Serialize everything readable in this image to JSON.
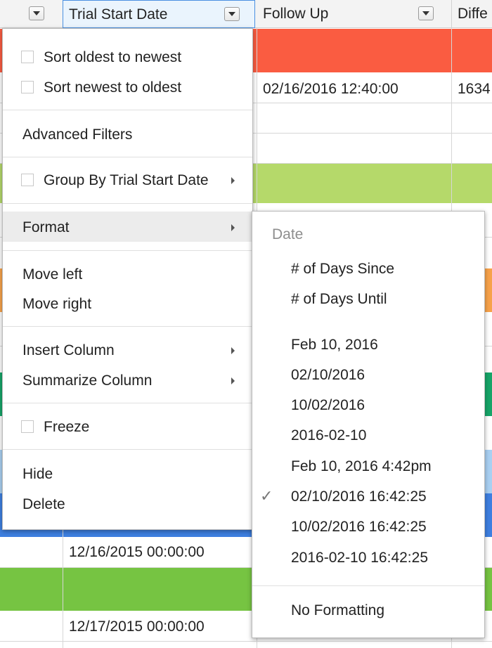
{
  "header": {
    "col2_title": "Trial Start Date",
    "col3_title": "Follow Up",
    "col4_title": "Diffe"
  },
  "grid": {
    "row2_followup": "02/16/2016 12:40:00",
    "row2_diff": "1634",
    "row_a_start": "12/16/2015 00:00:00",
    "row_b_start": "12/17/2015 00:00:00"
  },
  "colors": {
    "red": "#fa5c41",
    "lightgreen": "#b5d96a",
    "orange": "#f7a24a",
    "teal": "#16a568",
    "lightblue": "#a9d0f2",
    "blue": "#3e7fe0",
    "green": "#76c442"
  },
  "menu": {
    "sort_oldest": "Sort oldest to newest",
    "sort_newest": "Sort newest to oldest",
    "advanced_filters": "Advanced Filters",
    "group_by": "Group By Trial Start Date",
    "format": "Format",
    "move_left": "Move left",
    "move_right": "Move right",
    "insert_column": "Insert Column",
    "summarize_column": "Summarize Column",
    "freeze": "Freeze",
    "hide": "Hide",
    "delete": "Delete"
  },
  "submenu": {
    "heading": "Date",
    "days_since": "# of Days Since",
    "days_until": "# of Days Until",
    "formats": [
      "Feb 10, 2016",
      "02/10/2016",
      "10/02/2016",
      "2016-02-10",
      "Feb 10, 2016 4:42pm",
      "02/10/2016 16:42:25",
      "10/02/2016 16:42:25",
      "2016-02-10 16:42:25"
    ],
    "selected_index": 5,
    "checkmark": "✓",
    "no_formatting": "No Formatting"
  }
}
